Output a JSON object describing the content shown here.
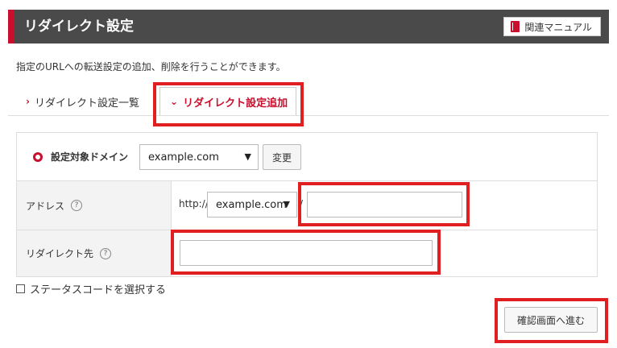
{
  "header": {
    "title": "リダイレクト設定",
    "manual_label": "関連マニュアル"
  },
  "description": "指定のURLへの転送設定の追加、削除を行うことができます。",
  "tabs": [
    {
      "label": "リダイレクト設定一覧",
      "active": false
    },
    {
      "label": "リダイレクト設定追加",
      "active": true
    }
  ],
  "form": {
    "domain": {
      "label": "設定対象ドメイン",
      "selected": "example.com",
      "change_label": "変更"
    },
    "address": {
      "label": "アドレス",
      "help": "?",
      "prefix": "http://",
      "domain_selected": "example.com",
      "separator": "/",
      "path_value": ""
    },
    "redirect_to": {
      "label": "リダイレクト先",
      "help": "?",
      "value": ""
    }
  },
  "status_code_checkbox": {
    "label": "ステータスコードを選択する",
    "checked": false
  },
  "confirm_button": "確認画面へ進む",
  "colors": {
    "accent": "#c8102e",
    "header_bg": "#4a4a4a",
    "highlight": "#e02020"
  },
  "icons": {
    "manual": "book-icon",
    "tab_inactive": "chevron-right-icon",
    "tab_active": "chevron-down-icon",
    "domain": "radio-target-icon",
    "help": "help-icon"
  }
}
